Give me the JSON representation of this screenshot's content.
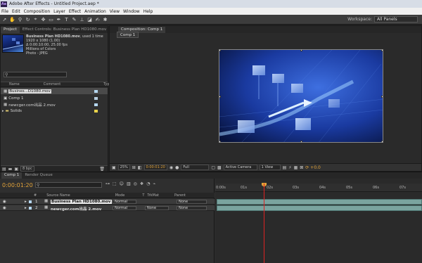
{
  "app": {
    "title": "Adobe After Effects - Untitled Project.aep *",
    "logo": "Ae"
  },
  "menu": [
    "File",
    "Edit",
    "Composition",
    "Layer",
    "Effect",
    "Animation",
    "View",
    "Window",
    "Help"
  ],
  "toolbar": {
    "tools": [
      "selection-tool",
      "hand-tool",
      "zoom-tool",
      "rotate-tool",
      "camera-tool",
      "pan-behind-tool",
      "rectangle-tool",
      "pen-tool",
      "text-tool",
      "brush-tool",
      "clone-stamp-tool",
      "eraser-tool",
      "roto-brush-tool",
      "puppet-tool"
    ],
    "workspace_label": "Workspace:",
    "workspace_value": "All Panels"
  },
  "project_panel": {
    "tab_project": "Project",
    "tab_effect_controls": "Effect Controls: Business Plan HD1080.mov",
    "selected_name": "Business Plan HD1080.mov",
    "used_times": ", used 1 time",
    "info_lines": [
      "1920 x 1080 (1.00)",
      "Δ 0:00:10:00, 25.00 fps",
      "Millions of Colors",
      "Photo - JPEG"
    ],
    "columns": {
      "name": "Name",
      "comment": "Comment",
      "type": "Typ"
    },
    "items": [
      {
        "name": "Busines...D1080.mov",
        "chip": "#b5d7f0"
      },
      {
        "name": "Comp 1",
        "chip": "#b8cfe0"
      },
      {
        "name": "newcger.com出品 2.mov",
        "chip": "#b5d7f0"
      },
      {
        "name": "Solids",
        "chip": "#e8d24a"
      }
    ],
    "bpc": "8 bpc"
  },
  "composition": {
    "tab": "Composition: Comp 1",
    "sub_tab": "Comp 1",
    "zoom": "25%",
    "timecode": "0:00:01:20",
    "resolution": "Full",
    "camera": "Active Camera",
    "view": "1 View",
    "exposure": "+0.0"
  },
  "timeline": {
    "tab_comp": "Comp 1",
    "tab_render": "Render Queue",
    "current_time": "0:00:01:20",
    "headers": {
      "num": "#",
      "source": "Source Name",
      "mode": "Mode",
      "t": "T",
      "trkmat": "TrkMat",
      "parent": "Parent"
    },
    "layers": [
      {
        "num": "1",
        "name": "Business Plan HD1080.mov",
        "mode": "Normal",
        "trkmat": "",
        "parent": "None"
      },
      {
        "num": "2",
        "name": "newcger.com出品 2.mov",
        "mode": "Normal",
        "trkmat": "None",
        "parent": "None"
      }
    ],
    "ruler": [
      "0:00s",
      "01s",
      "02s",
      "03s",
      "04s",
      "05s",
      "06s",
      "07s"
    ],
    "playhead_fraction": 0.233
  },
  "colors": {
    "accent": "#e2a33a",
    "playhead": "#d22222",
    "layer_bar": "#7aa39f"
  }
}
